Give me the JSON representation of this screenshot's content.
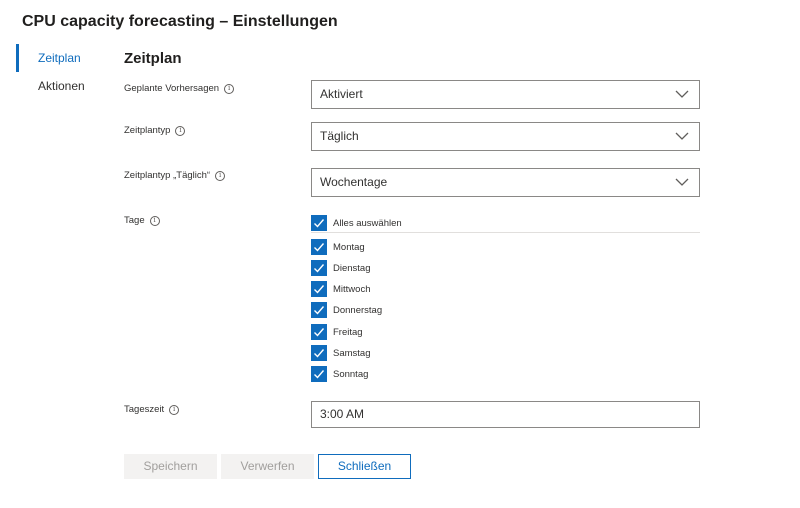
{
  "page": {
    "title": "CPU capacity forecasting – Einstellungen"
  },
  "nav": {
    "items": [
      {
        "label": "Zeitplan",
        "active": true
      },
      {
        "label": "Aktionen",
        "active": false
      }
    ]
  },
  "section": {
    "title": "Zeitplan"
  },
  "fields": {
    "scheduled": {
      "label": "Geplante Vorhersagen",
      "value": "Aktiviert"
    },
    "schedule_type": {
      "label": "Zeitplantyp",
      "value": "Täglich"
    },
    "daily_type": {
      "label": "Zeitplantyp „Täglich“",
      "value": "Wochentage"
    },
    "days": {
      "label": "Tage",
      "select_all": {
        "label": "Alles auswählen",
        "checked": true
      },
      "items": [
        {
          "label": "Montag",
          "checked": true
        },
        {
          "label": "Dienstag",
          "checked": true
        },
        {
          "label": "Mittwoch",
          "checked": true
        },
        {
          "label": "Donnerstag",
          "checked": true
        },
        {
          "label": "Freitag",
          "checked": true
        },
        {
          "label": "Samstag",
          "checked": true
        },
        {
          "label": "Sonntag",
          "checked": true
        }
      ]
    },
    "time": {
      "label": "Tageszeit",
      "value": "3:00 AM"
    }
  },
  "buttons": {
    "save": "Speichern",
    "discard": "Verwerfen",
    "close": "Schließen"
  },
  "colors": {
    "accent": "#0f6cbd"
  },
  "icons": {
    "info": "info-icon",
    "dropdown": "chevron-down-icon",
    "check": "checkmark-icon"
  }
}
